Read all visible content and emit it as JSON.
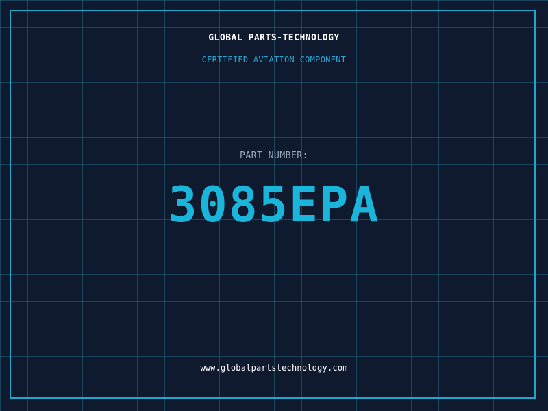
{
  "header": {
    "brand": "GLOBAL PARTS-TECHNOLOGY",
    "tagline": "CERTIFIED AVIATION COMPONENT"
  },
  "part": {
    "label": "PART NUMBER:",
    "number": "3085EPA"
  },
  "footer": {
    "website": "www.globalpartstechnology.com"
  },
  "colors": {
    "background": "#0f1a2e",
    "accent": "#1bb4da",
    "frame": "#1ea7cc",
    "label": "#9aa7b8",
    "text": "#ffffff"
  }
}
